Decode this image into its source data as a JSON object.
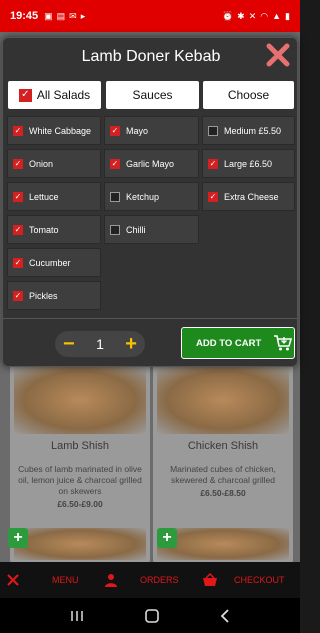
{
  "status_bar": {
    "time": "19:45",
    "left_icons": [
      "gallery-icon",
      "image-icon",
      "mail-icon",
      "play-icon"
    ],
    "right_icons": [
      "alarm-icon",
      "bluetooth-icon",
      "mute-icon",
      "wifi-icon",
      "signal-icon",
      "battery-icon"
    ]
  },
  "modal": {
    "title": "Lamb Doner Kebab",
    "close_icon": "close-icon",
    "columns": [
      {
        "label": "All Salads",
        "checked": true
      },
      {
        "label": "Sauces"
      },
      {
        "label": "Choose"
      }
    ],
    "salads": [
      {
        "label": "White Cabbage",
        "checked": true
      },
      {
        "label": "Onion",
        "checked": true
      },
      {
        "label": "Lettuce",
        "checked": true
      },
      {
        "label": "Tomato",
        "checked": true
      },
      {
        "label": "Cucumber",
        "checked": true
      },
      {
        "label": "Pickles",
        "checked": true
      }
    ],
    "sauces": [
      {
        "label": "Mayo",
        "checked": true
      },
      {
        "label": "Garlic Mayo",
        "checked": true
      },
      {
        "label": "Ketchup",
        "checked": false
      },
      {
        "label": "Chilli",
        "checked": false
      }
    ],
    "choose": [
      {
        "label": "Medium £5.50",
        "checked": false
      },
      {
        "label": "Large £6.50",
        "checked": true
      },
      {
        "label": "Extra Cheese",
        "checked": true
      }
    ],
    "quantity": {
      "minus": "−",
      "value": "1",
      "plus": "+"
    },
    "add_to_cart": "ADD TO CART"
  },
  "menu_items": [
    {
      "title": "Lamb Shish",
      "description": "Cubes of lamb marinated in olive oil, lemon juice & charcoal grilled on skewers",
      "price": "£6.50-£9.00"
    },
    {
      "title": "Chicken Shish",
      "description": "Marinated cubes of chicken, skewered & charcoal grilled",
      "price": "£6.50-£8.50"
    }
  ],
  "bottom_nav": {
    "menu": "MENU",
    "orders": "ORDERS",
    "checkout": "CHECKOUT"
  },
  "colors": {
    "brand_red": "#e00000",
    "checkbox_red": "#d42020",
    "add_cart_green": "#1e8a1e",
    "qty_yellow": "#f5c400"
  }
}
